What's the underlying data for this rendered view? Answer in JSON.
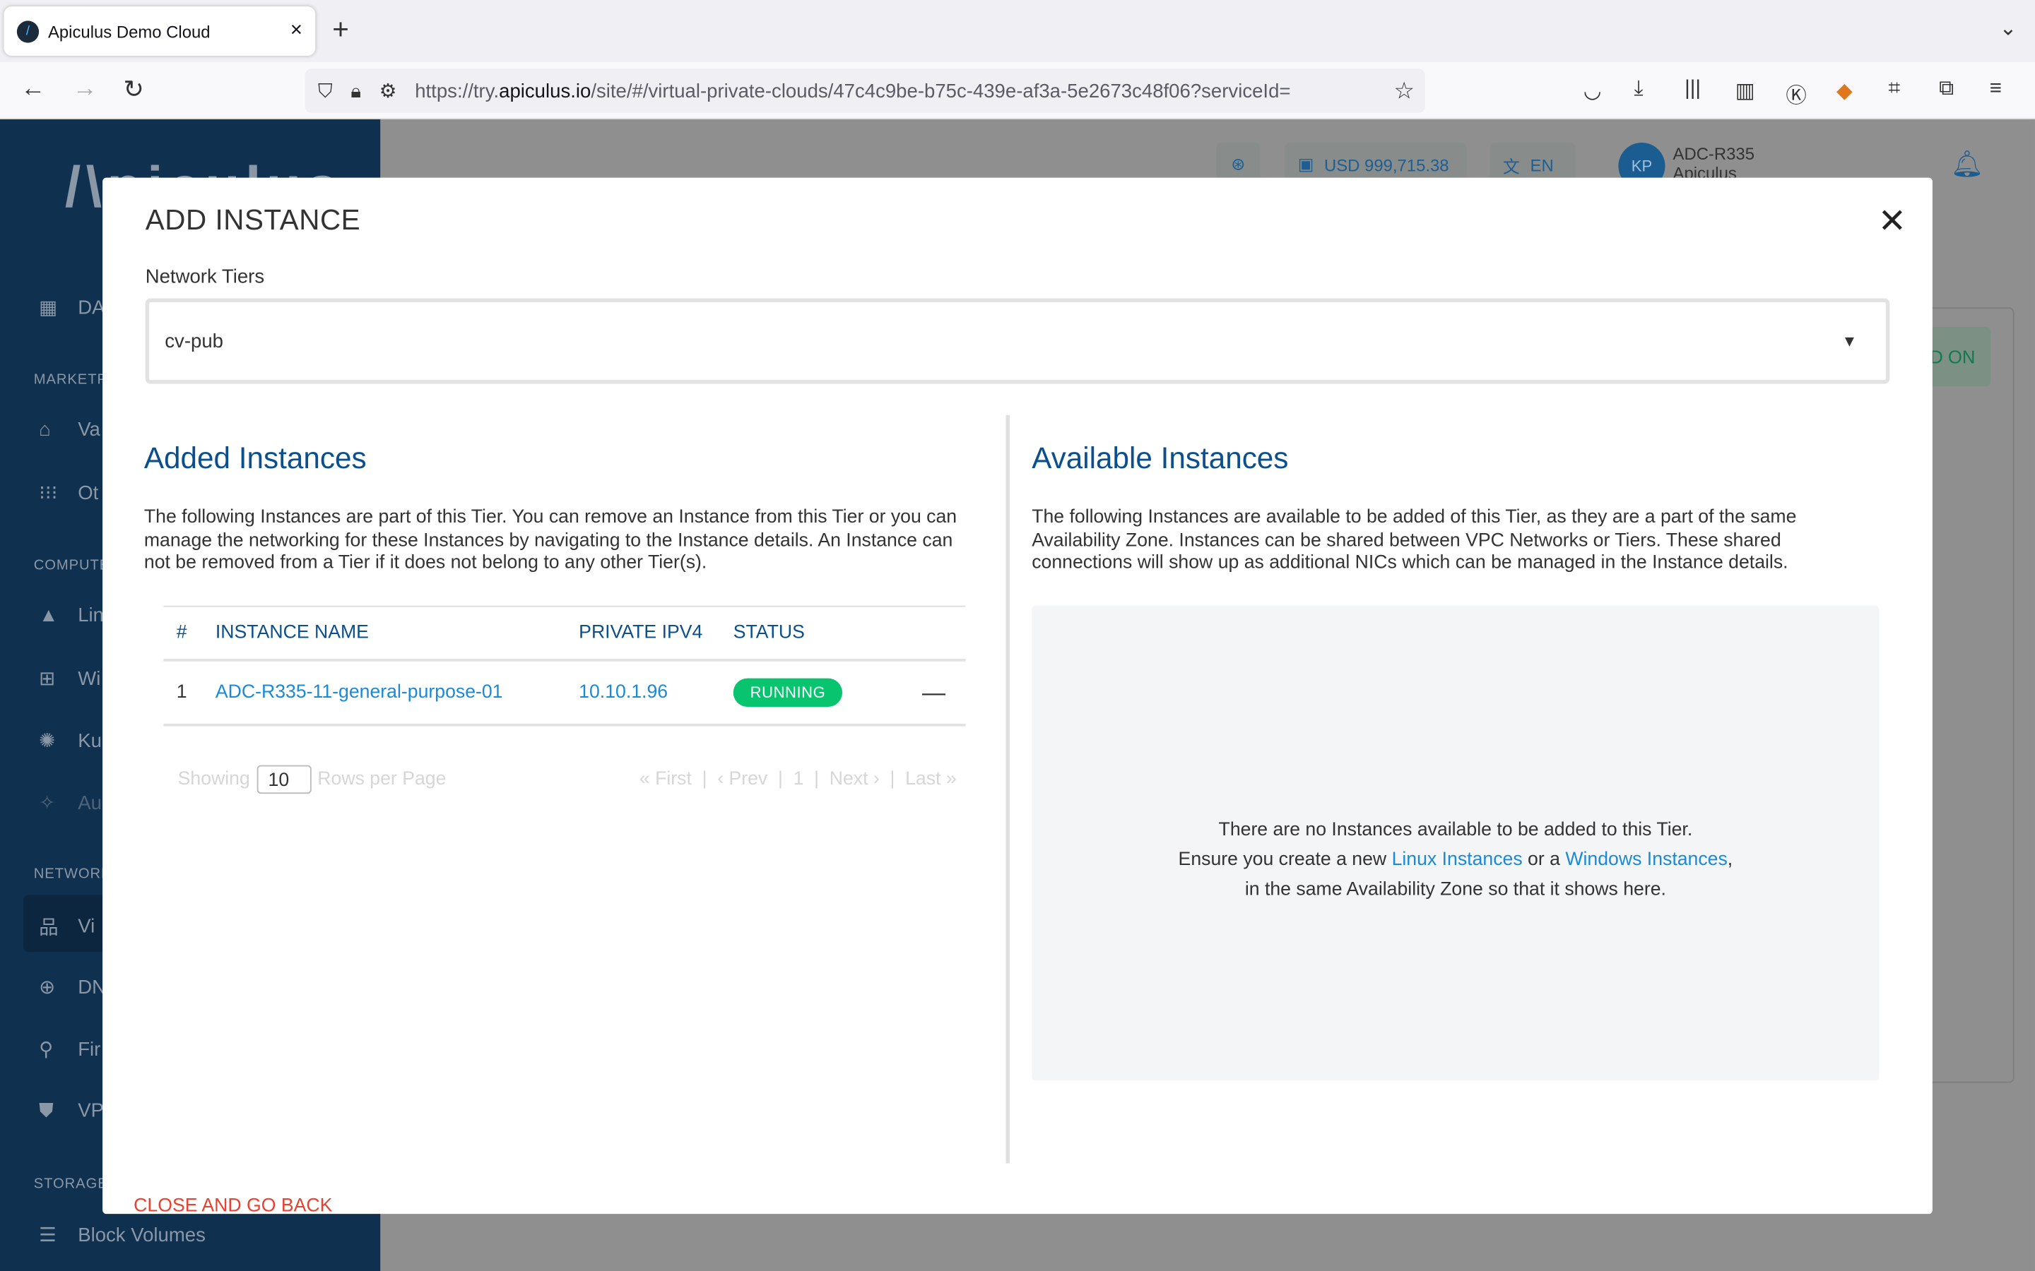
{
  "browser": {
    "tab_title": "Apiculus Demo Cloud",
    "url_prefix": "https://try.",
    "url_domain": "apiculus.io",
    "url_rest": "/site/#/virtual-private-clouds/47c4c9be-b75c-439e-af3a-5e2673c48f06?serviceId="
  },
  "sidebar": {
    "logo": "Apiculus",
    "dashboard": "DA",
    "sections": {
      "marketplace": "MARKETPL",
      "compute": "COMPUTE",
      "network": "NETWORK",
      "storage": "STORAGE"
    },
    "items": [
      {
        "label": "Va",
        "icon": "shapes-icon"
      },
      {
        "label": "Ot",
        "icon": "grid-icon"
      },
      {
        "label": "Lin",
        "icon": "linux-icon"
      },
      {
        "label": "Wi",
        "icon": "windows-icon"
      },
      {
        "label": "Ku",
        "icon": "kubernetes-icon"
      },
      {
        "label": "Au",
        "icon": "magic-wand-icon"
      },
      {
        "label": "Vi",
        "icon": "network-icon"
      },
      {
        "label": "DN",
        "icon": "globe-icon"
      },
      {
        "label": "Fir",
        "icon": "firewall-icon"
      },
      {
        "label": "VP",
        "icon": "shield-icon"
      },
      {
        "label": "Block Volumes",
        "icon": "storage-icon"
      }
    ]
  },
  "header": {
    "balance": "USD 999,715.38",
    "language": "EN",
    "avatar": "KP",
    "user": "ADC-R335",
    "org": "Apiculus",
    "bg_button": "D ON"
  },
  "modal": {
    "title": "ADD INSTANCE",
    "network_tiers_label": "Network Tiers",
    "network_tier_value": "cv-pub",
    "added": {
      "title": "Added Instances",
      "description": "The following Instances are part of this Tier. You can remove an Instance from this Tier or you can manage the networking for these Instances by navigating to the Instance details. An Instance can not be removed from a Tier if it does not belong to any other Tier(s).",
      "columns": [
        "#",
        "INSTANCE NAME",
        "PRIVATE IPV4",
        "STATUS"
      ],
      "rows": [
        {
          "index": "1",
          "name": "ADC-R335-11-general-purpose-01",
          "ip": "10.10.1.96",
          "status": "RUNNING"
        }
      ],
      "pager": {
        "showing": "Showing",
        "rows_per_page": "10",
        "rows_label": "Rows per Page",
        "first": "« First",
        "prev": "‹ Prev",
        "page": "1",
        "next": "Next ›",
        "last": "Last »"
      }
    },
    "available": {
      "title": "Available Instances",
      "description": "The following Instances are available to be added of this Tier, as they are a part of the same Availability Zone. Instances can be shared between VPC Networks or Tiers. These shared connections will show up as additional NICs which can be managed in the Instance details.",
      "empty_line1": "There are no Instances available to be added to this Tier.",
      "empty_pre": "Ensure you create a new ",
      "linux_link": "Linux Instances",
      "or": " or a ",
      "windows_link": "Windows Instances",
      "empty_post": ", in the same Availability Zone so that it shows here."
    },
    "close_back": "CLOSE AND GO BACK"
  },
  "colors": {
    "primary": "#0b4f8c",
    "link": "#1a8ad8",
    "running": "#09c46f",
    "danger": "#e8412f",
    "sidebar": "#10304f"
  }
}
